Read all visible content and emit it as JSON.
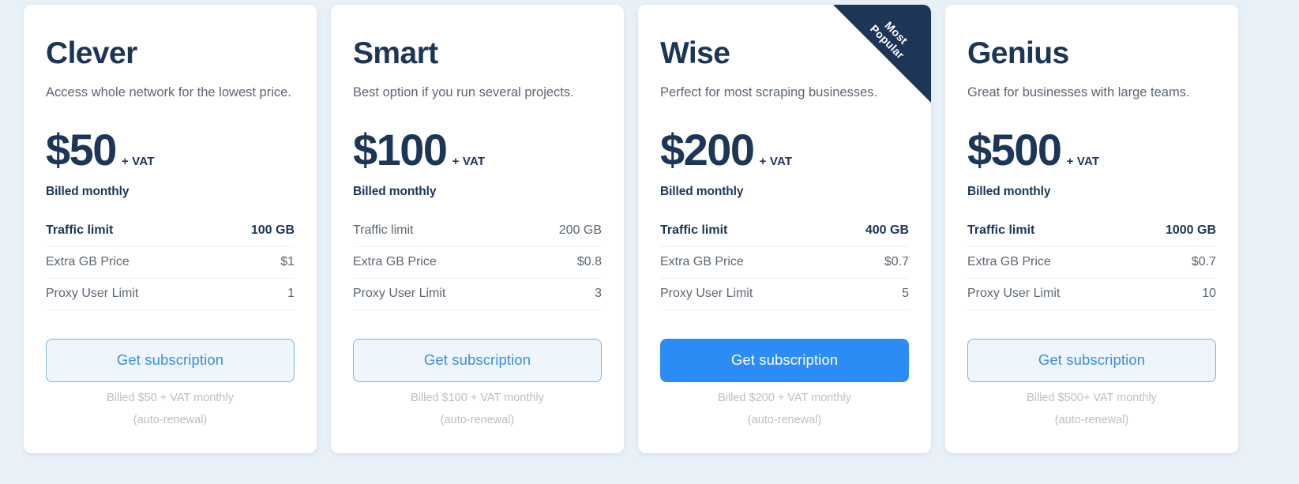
{
  "page": {
    "background_color": "#e9f1f8",
    "accent_color": "#2b8cf5",
    "dark_color": "#1d3557"
  },
  "ribbon": {
    "line1": "Most",
    "line2": "Popular"
  },
  "feature_labels": {
    "traffic_limit": "Traffic limit",
    "extra_gb_price": "Extra GB Price",
    "proxy_user_limit": "Proxy User Limit"
  },
  "cta": {
    "label": "Get subscription",
    "auto_renewal": "(auto-renewal)"
  },
  "plans": [
    {
      "name": "Clever",
      "tagline": "Access whole network for the lowest price.",
      "price": "$50",
      "vat": "+ VAT",
      "billed": "Billed monthly",
      "features": [
        {
          "label": "Traffic limit",
          "value": "100 GB",
          "emphasis": true
        },
        {
          "label": "Extra GB Price",
          "value": "$1",
          "emphasis": false
        },
        {
          "label": "Proxy User Limit",
          "value": "1",
          "emphasis": false
        }
      ],
      "cta_label": "Get subscription",
      "cta_style": "outline",
      "note": "Billed $50 + VAT monthly",
      "note2": "(auto-renewal)",
      "popular": false
    },
    {
      "name": "Smart",
      "tagline": "Best option if you run several projects.",
      "price": "$100",
      "vat": "+ VAT",
      "billed": "Billed monthly",
      "features": [
        {
          "label": "Traffic limit",
          "value": "200 GB",
          "emphasis": false
        },
        {
          "label": "Extra GB Price",
          "value": "$0.8",
          "emphasis": false
        },
        {
          "label": "Proxy User Limit",
          "value": "3",
          "emphasis": false
        }
      ],
      "cta_label": "Get subscription",
      "cta_style": "outline",
      "note": "Billed $100 + VAT monthly",
      "note2": "(auto-renewal)",
      "popular": false
    },
    {
      "name": "Wise",
      "tagline": "Perfect for most scraping businesses.",
      "price": "$200",
      "vat": "+ VAT",
      "billed": "Billed monthly",
      "features": [
        {
          "label": "Traffic limit",
          "value": "400 GB",
          "emphasis": true
        },
        {
          "label": "Extra GB Price",
          "value": "$0.7",
          "emphasis": false
        },
        {
          "label": "Proxy User Limit",
          "value": "5",
          "emphasis": false
        }
      ],
      "cta_label": "Get subscription",
      "cta_style": "solid",
      "note": "Billed $200 + VAT monthly",
      "note2": "(auto-renewal)",
      "popular": true
    },
    {
      "name": "Genius",
      "tagline": "Great for businesses with large teams.",
      "price": "$500",
      "vat": "+ VAT",
      "billed": "Billed monthly",
      "features": [
        {
          "label": "Traffic limit",
          "value": "1000 GB",
          "emphasis": true
        },
        {
          "label": "Extra GB Price",
          "value": "$0.7",
          "emphasis": false
        },
        {
          "label": "Proxy User Limit",
          "value": "10",
          "emphasis": false
        }
      ],
      "cta_label": "Get subscription",
      "cta_style": "outline",
      "note": "Billed $500+ VAT monthly",
      "note2": "(auto-renewal)",
      "popular": false
    }
  ]
}
